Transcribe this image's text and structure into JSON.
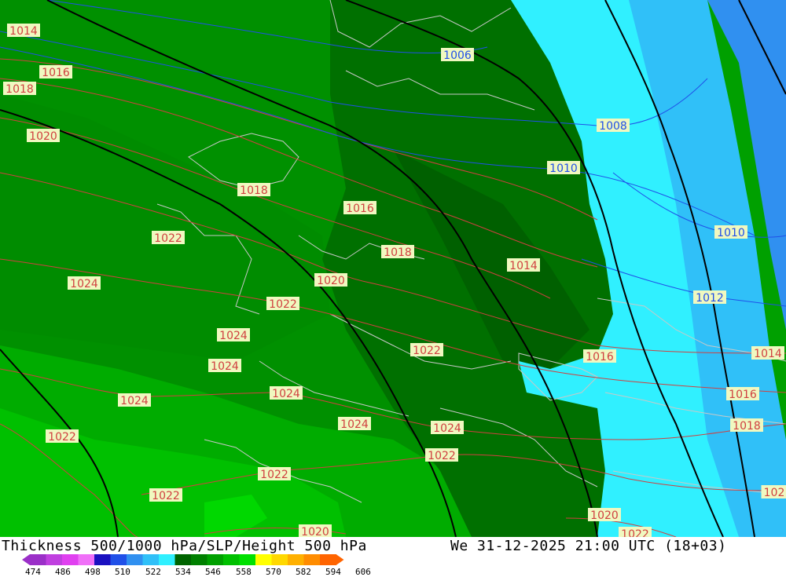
{
  "title": "Thickness 500/1000 hPa/SLP/Height 500 hPa",
  "valid_time": "We 31-12-2025 21:00 UTC (18+03)",
  "legend": {
    "ticks": [
      "474",
      "486",
      "498",
      "510",
      "522",
      "534",
      "546",
      "558",
      "570",
      "582",
      "594",
      "606"
    ],
    "colors": [
      "#9b30c8",
      "#c040e0",
      "#e040f0",
      "#f070f8",
      "#1a10c0",
      "#2050e8",
      "#3090f0",
      "#30c0f8",
      "#30f0ff",
      "#006400",
      "#008000",
      "#00a000",
      "#00c000",
      "#00e000",
      "#ffff00",
      "#ffd800",
      "#ffb000",
      "#ff8c00",
      "#ff6400"
    ]
  },
  "pressure_labels": [
    {
      "text": "1014",
      "color": "red"
    },
    {
      "text": "1016",
      "color": "red"
    },
    {
      "text": "1018",
      "color": "red"
    },
    {
      "text": "1020",
      "color": "red"
    },
    {
      "text": "1006",
      "color": "blue"
    },
    {
      "text": "1008",
      "color": "blue"
    },
    {
      "text": "1010",
      "color": "blue"
    },
    {
      "text": "1018",
      "color": "red"
    },
    {
      "text": "1016",
      "color": "red"
    },
    {
      "text": "1022",
      "color": "red"
    },
    {
      "text": "1018",
      "color": "red"
    },
    {
      "text": "1014",
      "color": "red"
    },
    {
      "text": "1010",
      "color": "blue"
    },
    {
      "text": "1024",
      "color": "red"
    },
    {
      "text": "1020",
      "color": "red"
    },
    {
      "text": "1022",
      "color": "red"
    },
    {
      "text": "1012",
      "color": "blue"
    },
    {
      "text": "1024",
      "color": "red"
    },
    {
      "text": "1022",
      "color": "red"
    },
    {
      "text": "1016",
      "color": "red"
    },
    {
      "text": "1014",
      "color": "red"
    },
    {
      "text": "1024",
      "color": "red"
    },
    {
      "text": "1024",
      "color": "red"
    },
    {
      "text": "1016",
      "color": "red"
    },
    {
      "text": "1024",
      "color": "red"
    },
    {
      "text": "1018",
      "color": "red"
    },
    {
      "text": "1024",
      "color": "red"
    },
    {
      "text": "1024",
      "color": "red"
    },
    {
      "text": "1022",
      "color": "red"
    },
    {
      "text": "1022",
      "color": "red"
    },
    {
      "text": "1022",
      "color": "red"
    },
    {
      "text": "1022",
      "color": "red"
    },
    {
      "text": "102",
      "color": "red"
    },
    {
      "text": "1020",
      "color": "red"
    },
    {
      "text": "1020",
      "color": "red"
    },
    {
      "text": "1022",
      "color": "red"
    }
  ]
}
